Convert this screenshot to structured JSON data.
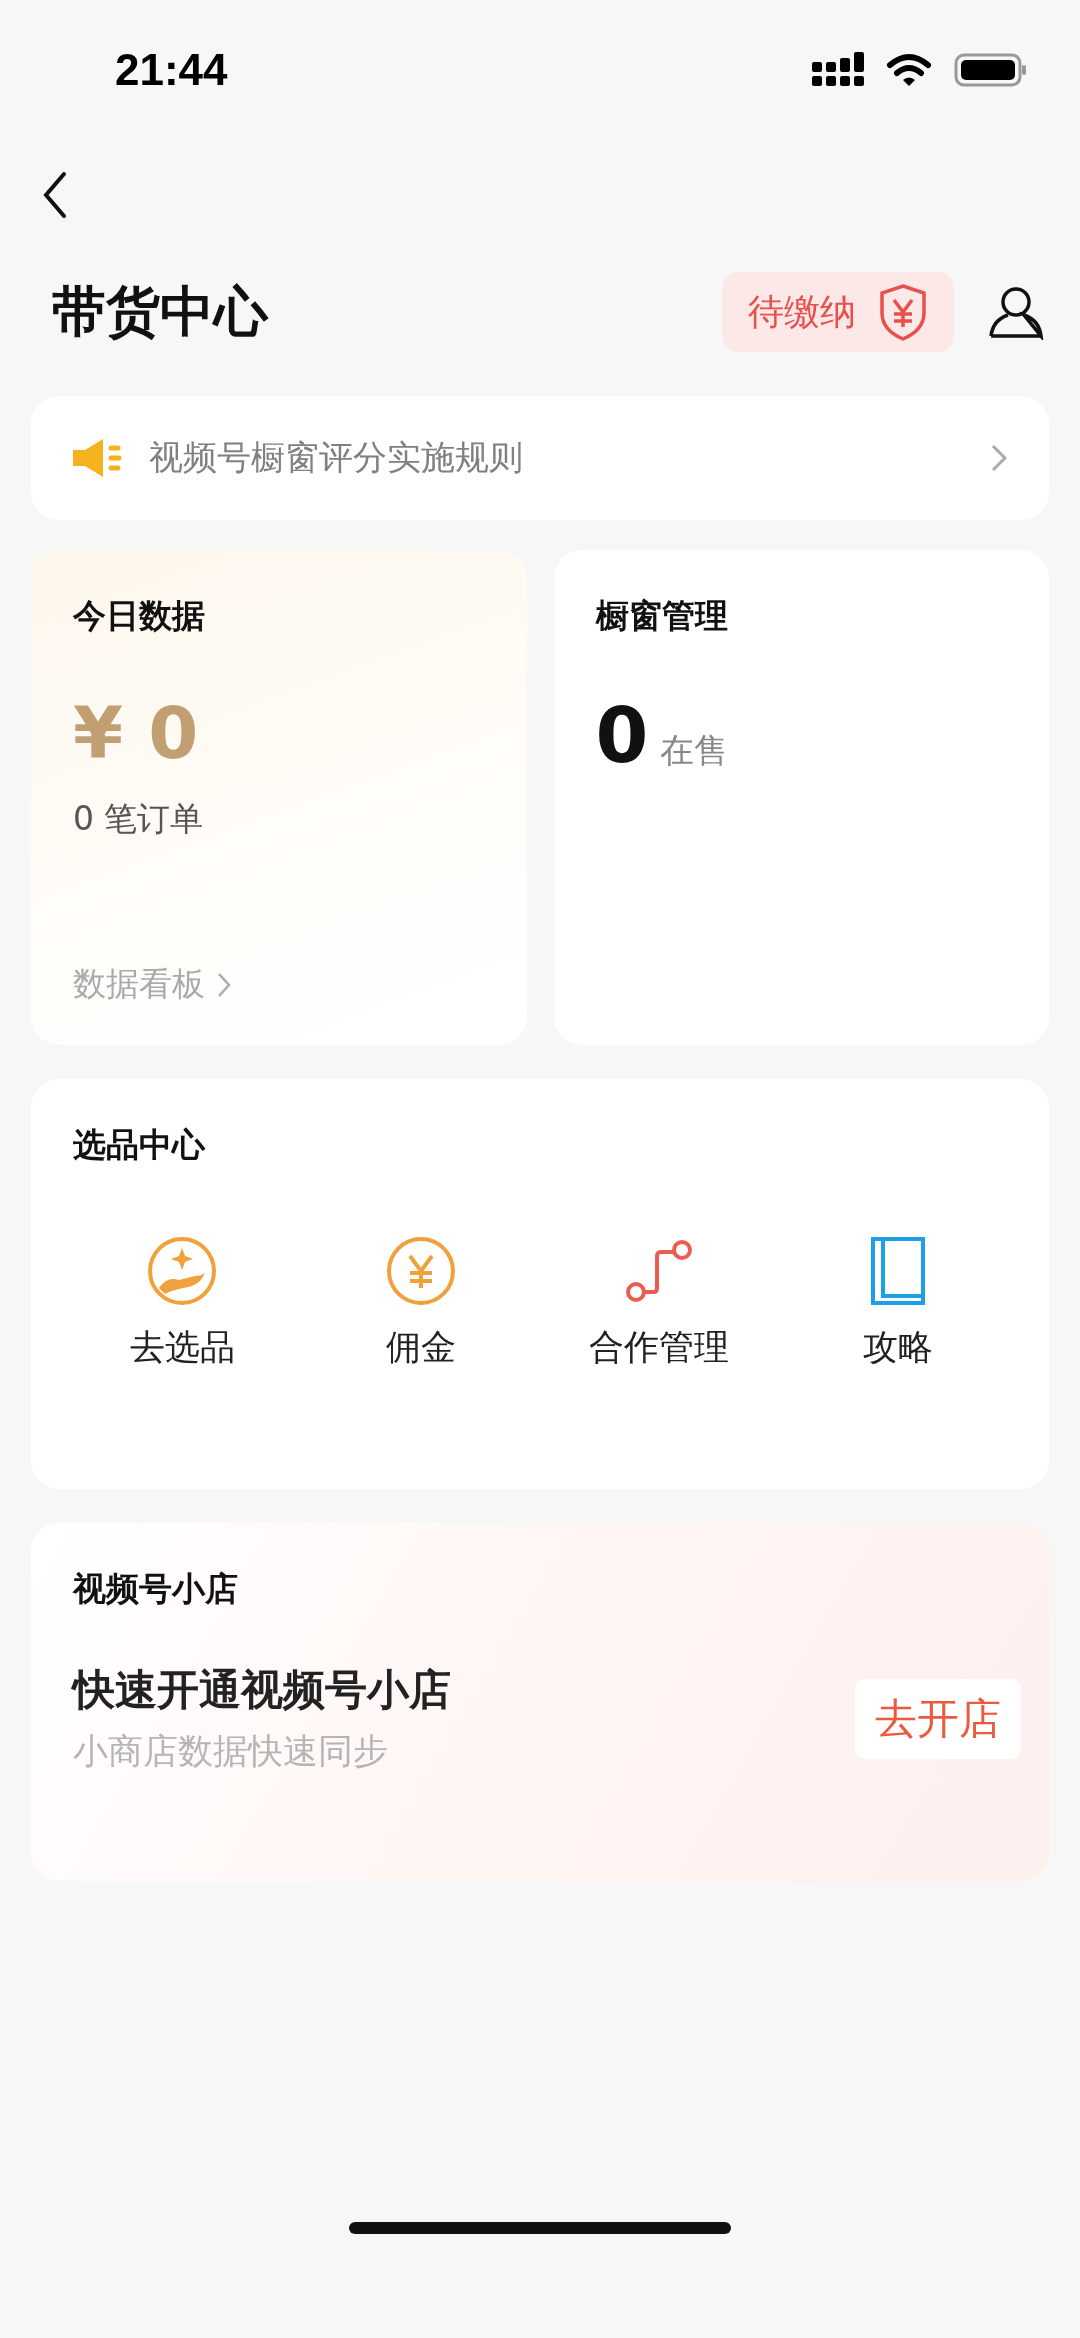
{
  "status_bar": {
    "time": "21:44"
  },
  "header": {
    "title": "带货中心",
    "badge": "待缴纳"
  },
  "notice": {
    "text": "视频号橱窗评分实施规则"
  },
  "today": {
    "title": "今日数据",
    "amount": "¥ 0",
    "orders": "0 笔订单",
    "link": "数据看板"
  },
  "window_mgmt": {
    "title": "橱窗管理",
    "count": "0",
    "count_label": "在售"
  },
  "selection": {
    "title": "选品中心",
    "items": [
      {
        "kind": "hand",
        "label": "去选品"
      },
      {
        "kind": "coin",
        "label": "佣金"
      },
      {
        "kind": "route",
        "label": "合作管理"
      },
      {
        "kind": "book",
        "label": "攻略"
      }
    ]
  },
  "shop": {
    "title": "视频号小店",
    "headline": "快速开通视频号小店",
    "subtitle": "小商店数据快速同步",
    "button": "去开店"
  }
}
